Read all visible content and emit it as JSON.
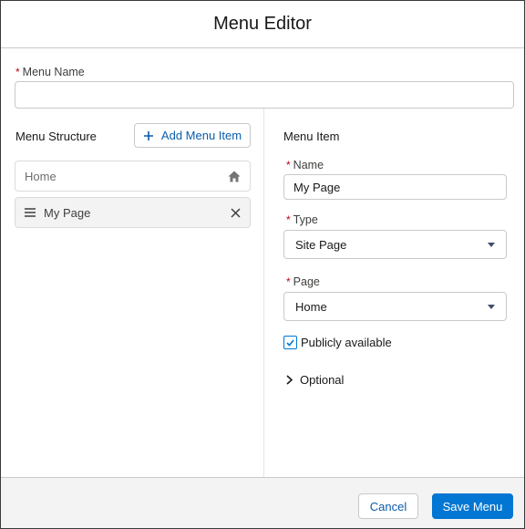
{
  "modal": {
    "title": "Menu Editor"
  },
  "menu_name": {
    "label": "Menu Name",
    "required_mark": "*",
    "value": "",
    "placeholder": ""
  },
  "structure": {
    "title": "Menu Structure",
    "add_button_label": "Add Menu Item",
    "items": [
      {
        "label": "Home",
        "icon": "home-icon"
      },
      {
        "label": "My Page",
        "icon": "close-icon",
        "handle_icon": "drag-handle-icon"
      }
    ]
  },
  "menu_item": {
    "title": "Menu Item",
    "name": {
      "label": "Name",
      "required_mark": "*",
      "value": "My Page"
    },
    "type": {
      "label": "Type",
      "required_mark": "*",
      "value": "Site Page"
    },
    "page": {
      "label": "Page",
      "required_mark": "*",
      "value": "Home"
    },
    "publicly_available": {
      "label": "Publicly available",
      "checked": true
    },
    "optional": {
      "label": "Optional"
    }
  },
  "footer": {
    "cancel_label": "Cancel",
    "save_label": "Save Menu"
  },
  "colors": {
    "brand": "#0176d3",
    "link": "#0b5cab",
    "required": "#ba0517",
    "footer_bg": "#f3f3f3"
  }
}
